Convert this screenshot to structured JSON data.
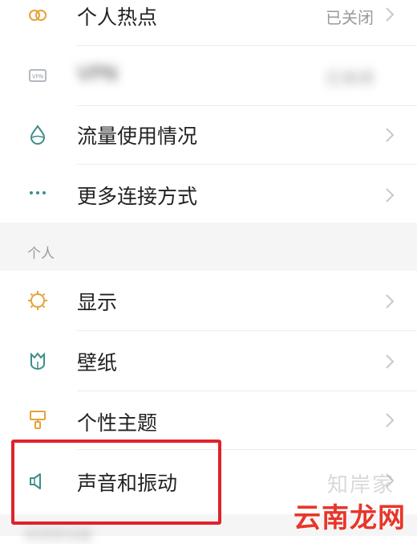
{
  "network": {
    "items": [
      {
        "label": "个人热点",
        "value": "已关闭",
        "icon": "hotspot-icon"
      },
      {
        "label": "VPN",
        "value": "",
        "icon": "vpn-icon"
      },
      {
        "label": "流量使用情况",
        "value": "",
        "icon": "data-usage-icon"
      },
      {
        "label": "更多连接方式",
        "value": "",
        "icon": "more-dots-icon"
      }
    ]
  },
  "personal": {
    "section_title": "个人",
    "items": [
      {
        "label": "显示",
        "icon": "sun-icon"
      },
      {
        "label": "壁纸",
        "icon": "wallpaper-icon"
      },
      {
        "label": "个性主题",
        "icon": "theme-brush-icon"
      },
      {
        "label": "声音和振动",
        "icon": "speaker-icon"
      }
    ]
  },
  "next_section_title_partial": "系统和设备",
  "watermark": {
    "faint_text": "知岸家",
    "main_text": "云南龙网"
  },
  "colors": {
    "icon_accent": "#e7a23a",
    "icon_teal": "#3c8f8a",
    "highlight_border": "#e0222a",
    "watermark_red": "#e8362b"
  },
  "vpn_value": "已关闭"
}
